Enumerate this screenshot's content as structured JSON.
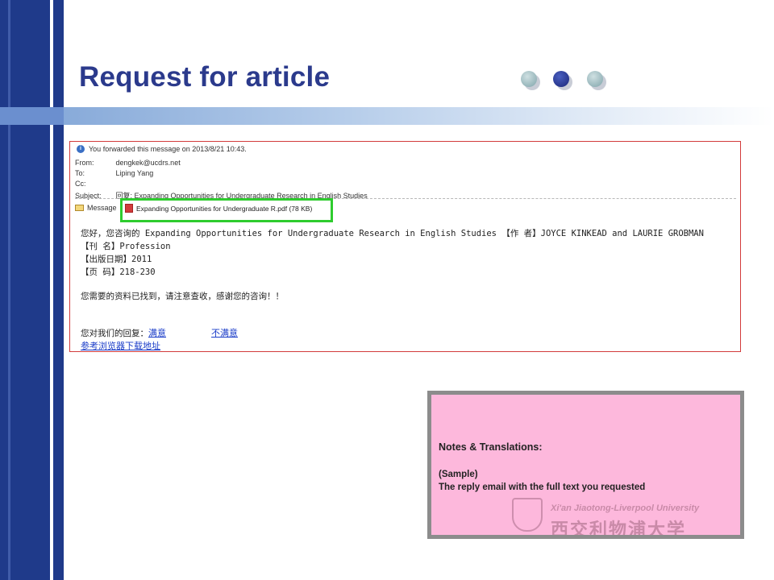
{
  "slide": {
    "title": "Request for article"
  },
  "email": {
    "forward_notice": "You forwarded this message on 2013/8/21 10:43.",
    "from_label": "From:",
    "from_value": "dengkek@ucdrs.net",
    "to_label": "To:",
    "to_value": "Liping Yang",
    "cc_label": "Cc:",
    "cc_value": "",
    "subject_label": "Subject:",
    "subject_value": "回复: Expanding Opportunities for Undergraduate Research in English Studies",
    "message_tab": "Message",
    "attachment": "Expanding Opportunities for Undergraduate R.pdf (78 KB)",
    "body": {
      "line1": "您好，您咨询的 Expanding Opportunities for Undergraduate Research in English Studies 【作 者】JOYCE KINKEAD and LAURIE GROBMAN",
      "line2": "【刊 名】Profession",
      "line3": "【出版日期】2011",
      "line4": "【页 码】218-230",
      "line5": "您需要的资料已找到，请注意查收，感谢您的咨询！！",
      "feedback_prefix": "您对我们的回复：",
      "satisfied": "满意",
      "unsatisfied": "不满意",
      "browser_link": "参考浏览器下载地址"
    }
  },
  "notes": {
    "title": "Notes & Translations:",
    "sample": "(Sample)",
    "description": "The reply email with the full text you requested",
    "university_en": "Xi'an Jiaotong-Liverpool University",
    "university_cn": "西交利物浦大学"
  },
  "colors": {
    "title": "#2b3a8c",
    "band": "#1f3a8a",
    "email_border": "#d23b3b",
    "highlight": "#2ecc2e",
    "notes_bg": "#fdb8dc",
    "dot_light": "#8fb3b8",
    "dot_dark": "#1f2f86"
  }
}
